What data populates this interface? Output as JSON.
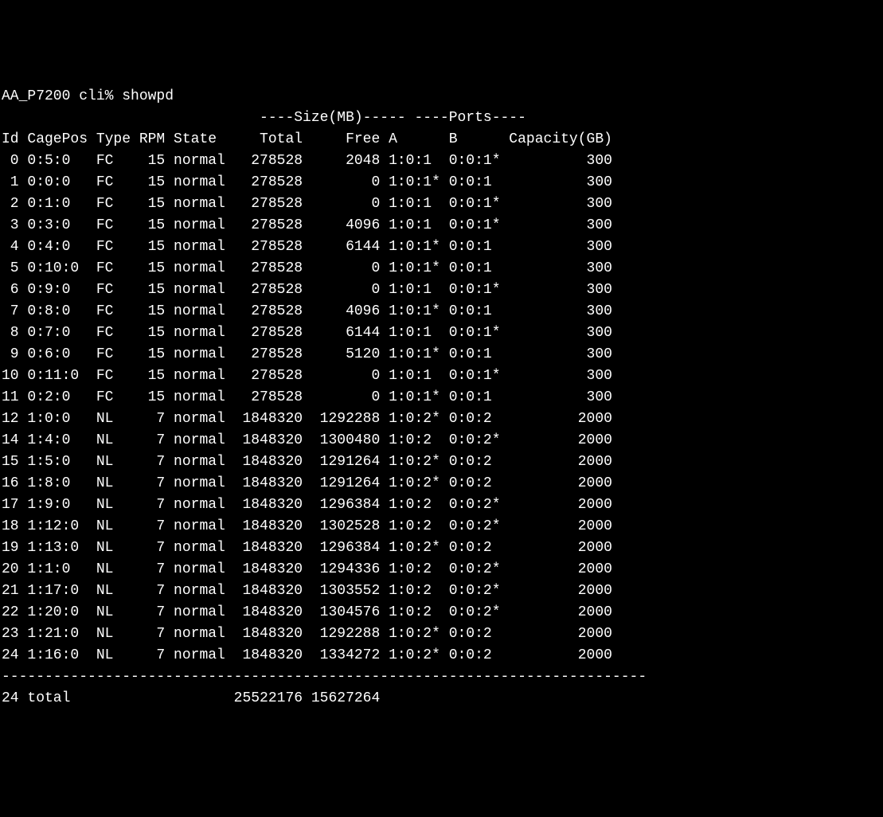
{
  "prompt": "AA_P7200 cli% ",
  "command": "showpd",
  "group_header": "                              ----Size(MB)----- ----Ports----",
  "columns": {
    "id": "Id",
    "cagepos": "CagePos",
    "type": "Type",
    "rpm": "RPM",
    "state": "State",
    "total": "Total",
    "free": "Free",
    "a": "A",
    "b": "B",
    "capacity": "Capacity(GB)"
  },
  "rows": [
    {
      "id": 0,
      "cagepos": "0:5:0",
      "type": "FC",
      "rpm": 15,
      "state": "normal",
      "total": 278528,
      "free": 2048,
      "a": "1:0:1",
      "b": "0:0:1*",
      "capacity": 300
    },
    {
      "id": 1,
      "cagepos": "0:0:0",
      "type": "FC",
      "rpm": 15,
      "state": "normal",
      "total": 278528,
      "free": 0,
      "a": "1:0:1*",
      "b": "0:0:1",
      "capacity": 300
    },
    {
      "id": 2,
      "cagepos": "0:1:0",
      "type": "FC",
      "rpm": 15,
      "state": "normal",
      "total": 278528,
      "free": 0,
      "a": "1:0:1",
      "b": "0:0:1*",
      "capacity": 300
    },
    {
      "id": 3,
      "cagepos": "0:3:0",
      "type": "FC",
      "rpm": 15,
      "state": "normal",
      "total": 278528,
      "free": 4096,
      "a": "1:0:1",
      "b": "0:0:1*",
      "capacity": 300
    },
    {
      "id": 4,
      "cagepos": "0:4:0",
      "type": "FC",
      "rpm": 15,
      "state": "normal",
      "total": 278528,
      "free": 6144,
      "a": "1:0:1*",
      "b": "0:0:1",
      "capacity": 300
    },
    {
      "id": 5,
      "cagepos": "0:10:0",
      "type": "FC",
      "rpm": 15,
      "state": "normal",
      "total": 278528,
      "free": 0,
      "a": "1:0:1*",
      "b": "0:0:1",
      "capacity": 300
    },
    {
      "id": 6,
      "cagepos": "0:9:0",
      "type": "FC",
      "rpm": 15,
      "state": "normal",
      "total": 278528,
      "free": 0,
      "a": "1:0:1",
      "b": "0:0:1*",
      "capacity": 300
    },
    {
      "id": 7,
      "cagepos": "0:8:0",
      "type": "FC",
      "rpm": 15,
      "state": "normal",
      "total": 278528,
      "free": 4096,
      "a": "1:0:1*",
      "b": "0:0:1",
      "capacity": 300
    },
    {
      "id": 8,
      "cagepos": "0:7:0",
      "type": "FC",
      "rpm": 15,
      "state": "normal",
      "total": 278528,
      "free": 6144,
      "a": "1:0:1",
      "b": "0:0:1*",
      "capacity": 300
    },
    {
      "id": 9,
      "cagepos": "0:6:0",
      "type": "FC",
      "rpm": 15,
      "state": "normal",
      "total": 278528,
      "free": 5120,
      "a": "1:0:1*",
      "b": "0:0:1",
      "capacity": 300
    },
    {
      "id": 10,
      "cagepos": "0:11:0",
      "type": "FC",
      "rpm": 15,
      "state": "normal",
      "total": 278528,
      "free": 0,
      "a": "1:0:1",
      "b": "0:0:1*",
      "capacity": 300
    },
    {
      "id": 11,
      "cagepos": "0:2:0",
      "type": "FC",
      "rpm": 15,
      "state": "normal",
      "total": 278528,
      "free": 0,
      "a": "1:0:1*",
      "b": "0:0:1",
      "capacity": 300
    },
    {
      "id": 12,
      "cagepos": "1:0:0",
      "type": "NL",
      "rpm": 7,
      "state": "normal",
      "total": 1848320,
      "free": 1292288,
      "a": "1:0:2*",
      "b": "0:0:2",
      "capacity": 2000
    },
    {
      "id": 14,
      "cagepos": "1:4:0",
      "type": "NL",
      "rpm": 7,
      "state": "normal",
      "total": 1848320,
      "free": 1300480,
      "a": "1:0:2",
      "b": "0:0:2*",
      "capacity": 2000
    },
    {
      "id": 15,
      "cagepos": "1:5:0",
      "type": "NL",
      "rpm": 7,
      "state": "normal",
      "total": 1848320,
      "free": 1291264,
      "a": "1:0:2*",
      "b": "0:0:2",
      "capacity": 2000
    },
    {
      "id": 16,
      "cagepos": "1:8:0",
      "type": "NL",
      "rpm": 7,
      "state": "normal",
      "total": 1848320,
      "free": 1291264,
      "a": "1:0:2*",
      "b": "0:0:2",
      "capacity": 2000
    },
    {
      "id": 17,
      "cagepos": "1:9:0",
      "type": "NL",
      "rpm": 7,
      "state": "normal",
      "total": 1848320,
      "free": 1296384,
      "a": "1:0:2",
      "b": "0:0:2*",
      "capacity": 2000
    },
    {
      "id": 18,
      "cagepos": "1:12:0",
      "type": "NL",
      "rpm": 7,
      "state": "normal",
      "total": 1848320,
      "free": 1302528,
      "a": "1:0:2",
      "b": "0:0:2*",
      "capacity": 2000
    },
    {
      "id": 19,
      "cagepos": "1:13:0",
      "type": "NL",
      "rpm": 7,
      "state": "normal",
      "total": 1848320,
      "free": 1296384,
      "a": "1:0:2*",
      "b": "0:0:2",
      "capacity": 2000
    },
    {
      "id": 20,
      "cagepos": "1:1:0",
      "type": "NL",
      "rpm": 7,
      "state": "normal",
      "total": 1848320,
      "free": 1294336,
      "a": "1:0:2",
      "b": "0:0:2*",
      "capacity": 2000
    },
    {
      "id": 21,
      "cagepos": "1:17:0",
      "type": "NL",
      "rpm": 7,
      "state": "normal",
      "total": 1848320,
      "free": 1303552,
      "a": "1:0:2",
      "b": "0:0:2*",
      "capacity": 2000
    },
    {
      "id": 22,
      "cagepos": "1:20:0",
      "type": "NL",
      "rpm": 7,
      "state": "normal",
      "total": 1848320,
      "free": 1304576,
      "a": "1:0:2",
      "b": "0:0:2*",
      "capacity": 2000
    },
    {
      "id": 23,
      "cagepos": "1:21:0",
      "type": "NL",
      "rpm": 7,
      "state": "normal",
      "total": 1848320,
      "free": 1292288,
      "a": "1:0:2*",
      "b": "0:0:2",
      "capacity": 2000
    },
    {
      "id": 24,
      "cagepos": "1:16:0",
      "type": "NL",
      "rpm": 7,
      "state": "normal",
      "total": 1848320,
      "free": 1334272,
      "a": "1:0:2*",
      "b": "0:0:2",
      "capacity": 2000
    }
  ],
  "separator": "---------------------------------------------------------------------------",
  "totals": {
    "count": 24,
    "label": "total",
    "total": 25522176,
    "free": 15627264
  }
}
